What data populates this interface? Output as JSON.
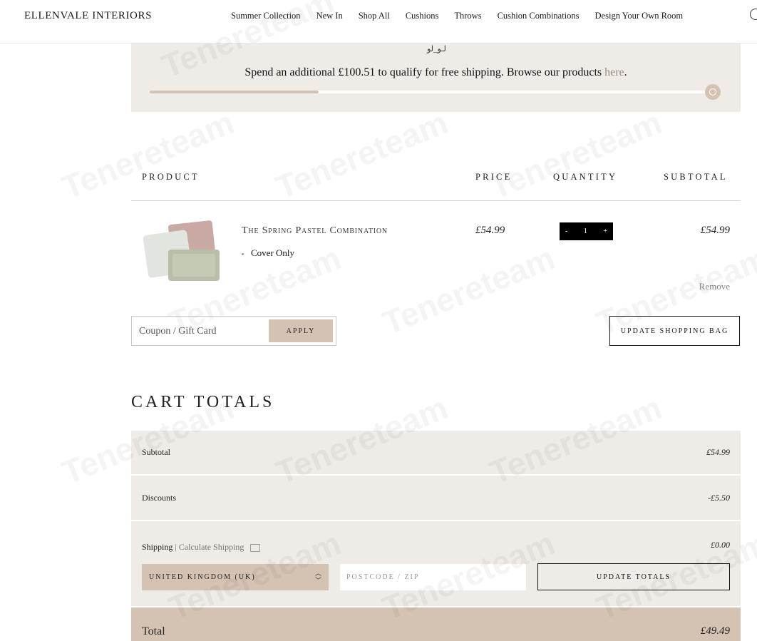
{
  "header": {
    "brand": "ELLENVALE INTERIORS",
    "nav": [
      "Summer Collection",
      "New In",
      "Shop All",
      "Cushions",
      "Throws",
      "Cushion Combinations",
      "Design Your Own Room"
    ]
  },
  "banner": {
    "logo_text": "لـو_لو",
    "message": "Spend an additional £100.51 to qualify for free shipping. Browse our products ",
    "link_text": "here",
    "link_suffix": ".",
    "progress_percent": 30
  },
  "table": {
    "headers": {
      "product": "PRODUCT",
      "price": "PRICE",
      "quantity": "QUANTITY",
      "subtotal": "SUBTOTAL"
    }
  },
  "item": {
    "name": "The Spring Pastel Combination",
    "variant": "Cover Only",
    "price": "£54.99",
    "quantity": "1",
    "qty_minus": "-",
    "qty_plus": "+",
    "subtotal": "£54.99",
    "remove_label": "Remove"
  },
  "coupon": {
    "placeholder": "Coupon / Gift Card",
    "apply_label": "APPLY"
  },
  "update_bag_label": "UPDATE SHOPPING BAG",
  "totals": {
    "title": "CART TOTALS",
    "subtotal_label": "Subtotal",
    "subtotal_value": "£54.99",
    "discounts_label": "Discounts",
    "discounts_value": "-£5.50",
    "shipping_label": "Shipping",
    "calc_shipping_label": "| Calculate Shipping",
    "shipping_value": "£0.00",
    "country": "UNITED KINGDOM (UK)",
    "postcode_placeholder": "POSTCODE / ZIP",
    "update_totals_label": "UPDATE TOTALS",
    "total_label": "Total",
    "total_value": "£49.49"
  },
  "watermark": "Tenereteam",
  "colors": {
    "beige_light": "#efebe6",
    "beige_accent": "#d4c3b3"
  }
}
